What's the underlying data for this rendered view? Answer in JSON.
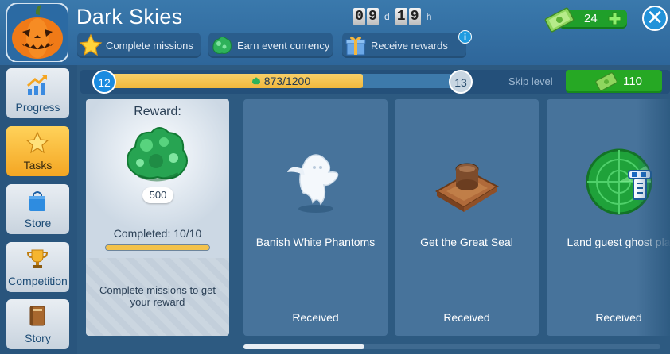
{
  "header": {
    "title": "Dark Skies",
    "timer": {
      "d1": "0",
      "d2": "9",
      "day_unit": "d",
      "h1": "1",
      "h2": "9",
      "hour_unit": "h"
    },
    "tabs": [
      {
        "label": "Complete missions",
        "icon": "star-icon"
      },
      {
        "label": "Earn event currency",
        "icon": "gem-icon"
      },
      {
        "label": "Receive rewards",
        "icon": "gift-icon"
      }
    ],
    "info_label": "i",
    "currency": {
      "value": "24",
      "icon": "cash-icon"
    },
    "close_label": "✕"
  },
  "sidebar": {
    "items": [
      {
        "label": "Progress",
        "icon": "chart-up-icon"
      },
      {
        "label": "Tasks",
        "icon": "star-icon",
        "active": true
      },
      {
        "label": "Store",
        "icon": "shopping-bag-icon"
      },
      {
        "label": "Competition",
        "icon": "trophy-icon"
      },
      {
        "label": "Story",
        "icon": "book-icon"
      }
    ]
  },
  "progress": {
    "current_level": "12",
    "next_level": "13",
    "text": "873/1200",
    "fraction": 0.7275,
    "skip_label": "Skip level",
    "skip_cost": "110"
  },
  "reward": {
    "title": "Reward:",
    "amount": "500",
    "completed": "Completed: 10/10",
    "completed_fraction": 1.0,
    "description": "Complete missions to get your reward"
  },
  "missions": [
    {
      "name": "Banish White Phantoms",
      "status": "Received",
      "icon": "ghost-icon"
    },
    {
      "name": "Get the Great Seal",
      "status": "Received",
      "icon": "seal-icon"
    },
    {
      "name": "Land guest ghost pla",
      "status": "Received",
      "icon": "radar-icon"
    }
  ],
  "colors": {
    "header_bg": "#3a79ac",
    "panel_bg": "#2d5a81",
    "active_tab": "#f4a623",
    "green_button": "#26a824",
    "progress_fill": "#f0b83c"
  }
}
